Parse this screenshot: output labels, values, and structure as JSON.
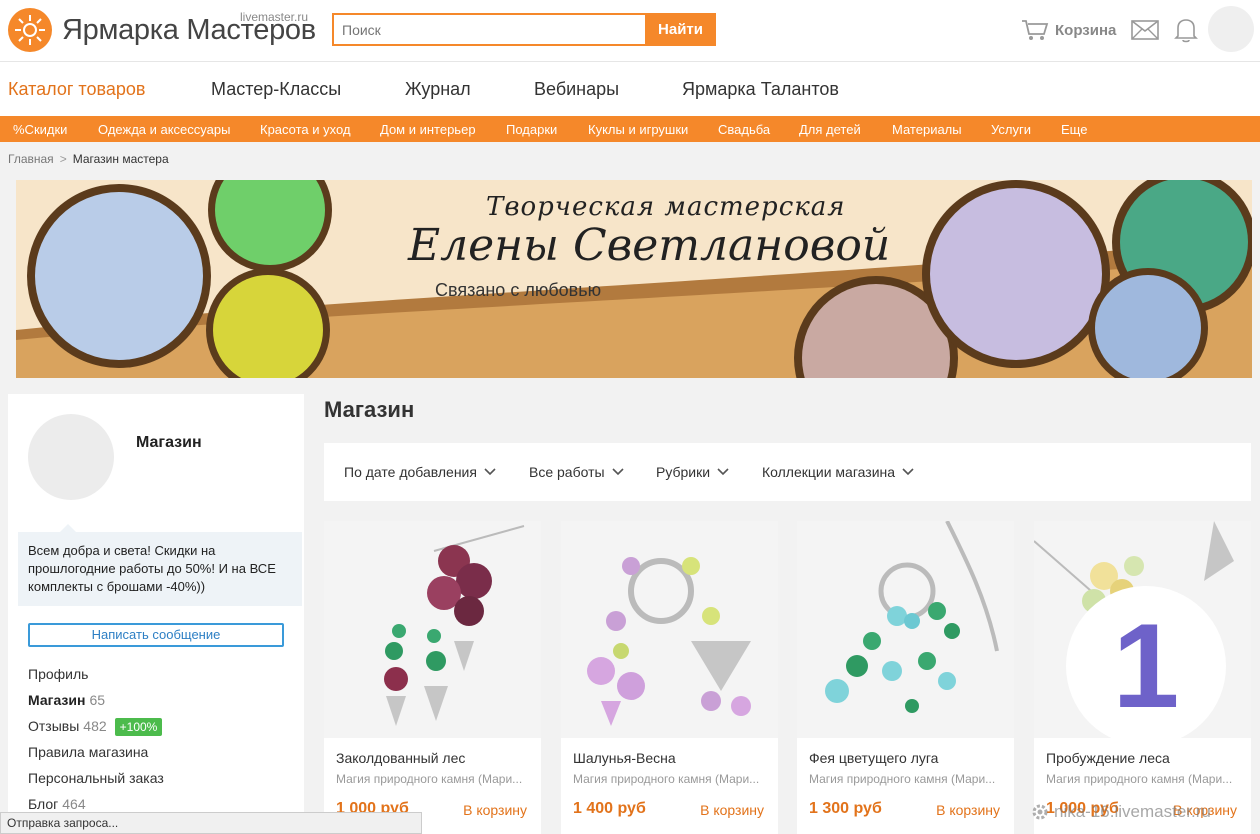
{
  "header": {
    "logo_text": "Ярмарка Мастеров",
    "logo_sub": "livemaster.ru",
    "search_placeholder": "Поиск",
    "search_button": "Найти",
    "cart_label": "Корзина"
  },
  "main_nav": [
    "Каталог товаров",
    "Мастер-Классы",
    "Журнал",
    "Вебинары",
    "Ярмарка Талантов"
  ],
  "categories": [
    "%Скидки",
    "Одежда и аксессуары",
    "Красота и уход",
    "Дом и интерьер",
    "Подарки",
    "Куклы и игрушки",
    "Свадьба",
    "Для детей",
    "Материалы",
    "Услуги",
    "Еще"
  ],
  "breadcrumb": {
    "home": "Главная",
    "separator": ">",
    "current": "Магазин мастера"
  },
  "banner": {
    "line1": "Творческая мастерская",
    "line2": "Елены Светлановой",
    "tagline": "Связано с любовью"
  },
  "sidebar": {
    "title": "Магазин",
    "note": "Всем добра и света! Скидки на прошлогодние работы до 50%! И на ВСЕ комплекты с брошами -40%))",
    "message_button": "Написать сообщение",
    "links": [
      {
        "label": "Профиль",
        "count": ""
      },
      {
        "label": "Магазин",
        "count": "65"
      },
      {
        "label": "Отзывы",
        "count": "482",
        "badge": "+100%"
      },
      {
        "label": "Правила магазина",
        "count": ""
      },
      {
        "label": "Персональный заказ",
        "count": ""
      },
      {
        "label": "Блог",
        "count": "464"
      }
    ]
  },
  "content": {
    "title": "Магазин",
    "filters": [
      "По дате добавления",
      "Все работы",
      "Рубрики",
      "Коллекции магазина"
    ],
    "products": [
      {
        "title": "Заколдованный лес",
        "subtitle": "Магия природного камня (Мари...",
        "price": "1 000 руб",
        "cart": "В корзину"
      },
      {
        "title": "Шалунья-Весна",
        "subtitle": "Магия природного камня (Мари...",
        "price": "1 400 руб",
        "cart": "В корзину"
      },
      {
        "title": "Фея цветущего луга",
        "subtitle": "Магия природного камня (Мари...",
        "price": "1 300 руб",
        "cart": "В корзину"
      },
      {
        "title": "Пробуждение леса",
        "subtitle": "Магия природного камня (Мари...",
        "price": "1 000 руб",
        "cart": "В корзину"
      }
    ],
    "overlay_number": "1"
  },
  "status_text": "Отправка запроса...",
  "watermark": "nika-16.livemaster.ru",
  "colors": {
    "accent": "#f5882a",
    "link_blue": "#3a9ad9",
    "badge_green": "#4cbb4c",
    "number": "#6e62c9"
  }
}
